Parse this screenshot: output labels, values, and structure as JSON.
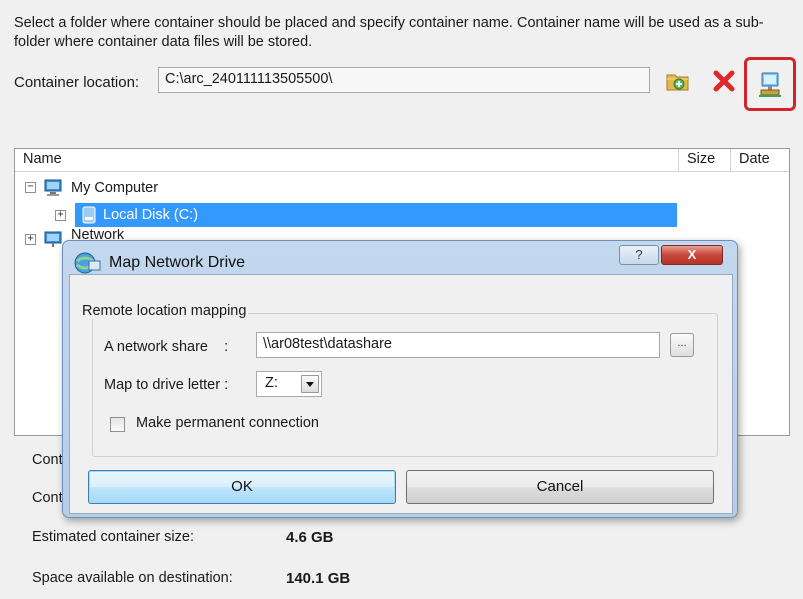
{
  "instructions": "Select a folder where container should be placed and specify container name. Container name will be used as a sub-folder where container data files will be stored.",
  "container_location": {
    "label": "Container location:",
    "value": "C:\\arc_240111113505500\\"
  },
  "toolbar": {
    "icons": [
      "new-folder-icon",
      "delete-icon",
      "map-network-drive-icon"
    ]
  },
  "tree": {
    "columns": {
      "name": "Name",
      "size": "Size",
      "date": "Date"
    },
    "items": [
      {
        "label": "My Computer",
        "icon": "computer-icon",
        "expander": "minus"
      },
      {
        "label": "Local Disk (C:)",
        "icon": "disk-icon",
        "expander": "plus",
        "selected": true
      },
      {
        "label": "Network",
        "icon": "network-icon",
        "expander": "plus"
      }
    ]
  },
  "info": {
    "row1_label": "Cont",
    "row2_label": "Cont",
    "estimated_label": "Estimated container size:",
    "estimated_value": "4.6 GB",
    "space_label": "Space available on destination:",
    "space_value": "140.1 GB"
  },
  "dialog": {
    "title": "Map Network Drive",
    "help_label": "?",
    "close_label": "X",
    "group_title": "Remote location mapping",
    "share_label": "A network share    :",
    "share_value": "\\\\ar08test\\datashare",
    "browse_label": "...",
    "drive_label": "Map to drive letter :",
    "drive_value": "Z:",
    "permanent_label": "Make permanent connection",
    "permanent_checked": false,
    "ok_label": "OK",
    "cancel_label": "Cancel"
  },
  "colors": {
    "selection": "#3399ff",
    "highlight_border": "#d1242c",
    "window_bg": "#f0f0f0",
    "dialog_frame": "#c3d8ef"
  }
}
